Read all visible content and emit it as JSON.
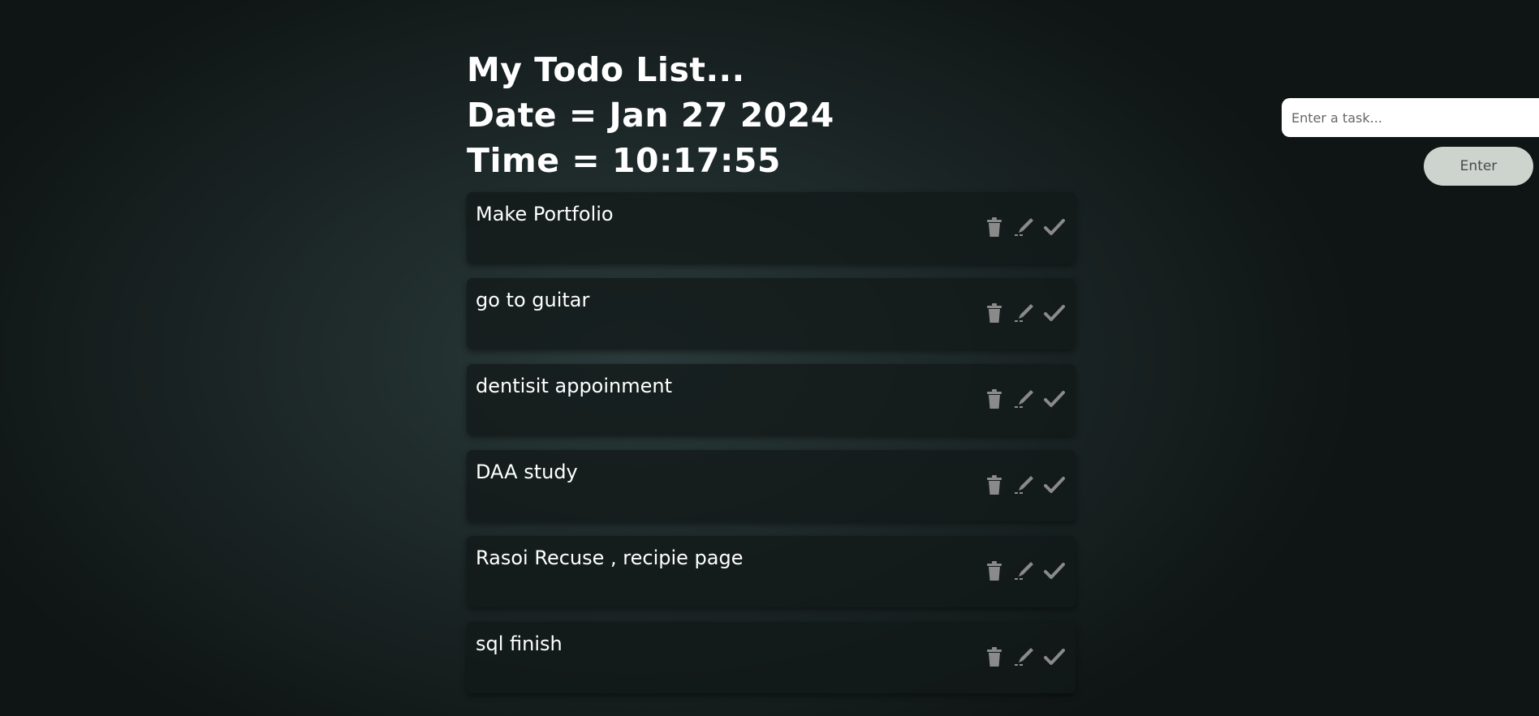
{
  "header": {
    "title": "My Todo List...",
    "date_line": "Date = Jan 27 2024",
    "time_line": "Time = 10:17:55"
  },
  "tasks": [
    {
      "text": "Make Portfolio"
    },
    {
      "text": "go to guitar"
    },
    {
      "text": "dentisit appoinment"
    },
    {
      "text": "DAA study"
    },
    {
      "text": "Rasoi Recuse , recipie page"
    },
    {
      "text": "sql finish"
    }
  ],
  "task_actions": {
    "delete_icon": "trash-icon",
    "edit_icon": "pencil-icon",
    "complete_icon": "check-icon"
  },
  "input": {
    "placeholder": "Enter a task...",
    "value": ""
  },
  "enter_button": {
    "label": "Enter"
  },
  "colors": {
    "background": "#1b2525",
    "card": "#121818",
    "text": "#ffffff",
    "button_bg": "#cdd3cd",
    "icon_gray": "#8a8a8a"
  }
}
